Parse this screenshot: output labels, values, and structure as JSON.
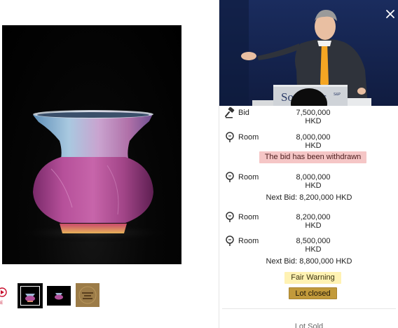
{
  "save": {
    "label": "VE"
  },
  "thumbnails": [
    {
      "name": "thumbnail-front-view"
    },
    {
      "name": "thumbnail-side-view"
    },
    {
      "name": "thumbnail-base-mark"
    }
  ],
  "video": {
    "lectern_text": "Sotheby's",
    "lectern_small": "S&P"
  },
  "bid_feed": {
    "rows": [
      {
        "type": "bid",
        "icon": "gavel-icon",
        "label": "Bid",
        "amount": "7,500,000 HKD"
      },
      {
        "type": "room",
        "icon": "room-bidder-icon",
        "label": "Room",
        "amount": "8,000,000 HKD"
      },
      {
        "type": "room",
        "icon": "room-bidder-icon",
        "label": "Room",
        "amount": "8,000,000 HKD"
      },
      {
        "type": "room",
        "icon": "room-bidder-icon",
        "label": "Room",
        "amount": "8,200,000 HKD"
      },
      {
        "type": "room",
        "icon": "room-bidder-icon",
        "label": "Room",
        "amount": "8,500,000 HKD"
      }
    ],
    "withdrawn_text": "The bid has been withdrawn",
    "next_bid_1": "Next Bid: 8,200,000 HKD",
    "next_bid_2": "Next Bid: 8,800,000 HKD",
    "fair_warning": "Fair Warning",
    "lot_closed": "Lot closed",
    "lot_sold": "Lot Sold"
  },
  "colors": {
    "withdrawn_bg": "#f5c6c6",
    "fair_warning_bg": "#fff2b3",
    "lot_closed_bg": "#c29a3b",
    "brand_red": "#c8102e"
  }
}
